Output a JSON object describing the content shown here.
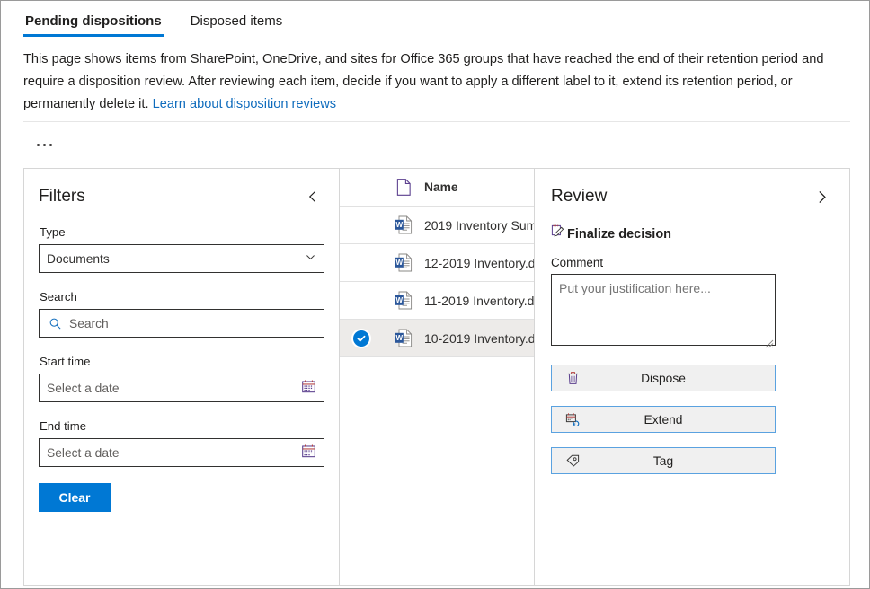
{
  "tabs": [
    {
      "label": "Pending dispositions",
      "active": true
    },
    {
      "label": "Disposed items",
      "active": false
    }
  ],
  "description": {
    "text_before_link": "This page shows items from SharePoint, OneDrive, and sites for Office 365 groups that have reached the end of their retention period and require a disposition review. After reviewing each item, decide if you want to apply a different label to it, extend its retention period, or permanently delete it. ",
    "link_text": "Learn about disposition reviews"
  },
  "overflow_menu": {
    "label": "..."
  },
  "filters": {
    "title": "Filters",
    "collapse_icon": "chevron-left-icon",
    "type": {
      "label": "Type",
      "value": "Documents",
      "chevron": "chevron-down-icon"
    },
    "search": {
      "label": "Search",
      "placeholder": "Search",
      "value": "",
      "icon": "search-icon"
    },
    "start_time": {
      "label": "Start time",
      "placeholder": "Select a date",
      "value": "",
      "icon": "calendar-icon"
    },
    "end_time": {
      "label": "End time",
      "placeholder": "Select a date",
      "value": "",
      "icon": "calendar-icon"
    },
    "clear_button": "Clear"
  },
  "list": {
    "columns": {
      "file_icon": "file-icon",
      "name": "Name"
    },
    "rows": [
      {
        "name": "2019 Inventory Sum",
        "icon": "word-doc-icon",
        "selected": false
      },
      {
        "name": "12-2019 Inventory.d",
        "icon": "word-doc-icon",
        "selected": false
      },
      {
        "name": "11-2019 Inventory.d",
        "icon": "word-doc-icon",
        "selected": false
      },
      {
        "name": "10-2019 Inventory.d",
        "icon": "word-doc-icon",
        "selected": true
      }
    ]
  },
  "review": {
    "title": "Review",
    "expand_icon": "chevron-right-icon",
    "finalize_heading": "Finalize decision",
    "finalize_icon": "edit-note-icon",
    "comment_label": "Comment",
    "comment_placeholder": "Put your justification here...",
    "comment_value": "",
    "actions": [
      {
        "label": "Dispose",
        "icon": "trash-icon"
      },
      {
        "label": "Extend",
        "icon": "calendar-sync-icon"
      },
      {
        "label": "Tag",
        "icon": "tag-icon"
      }
    ]
  },
  "colors": {
    "accent": "#0078d4",
    "link": "#0f6cbd",
    "selected_row": "#edebe9",
    "button_border": "#5aa2e0",
    "button_fill": "#f0f0f0"
  }
}
